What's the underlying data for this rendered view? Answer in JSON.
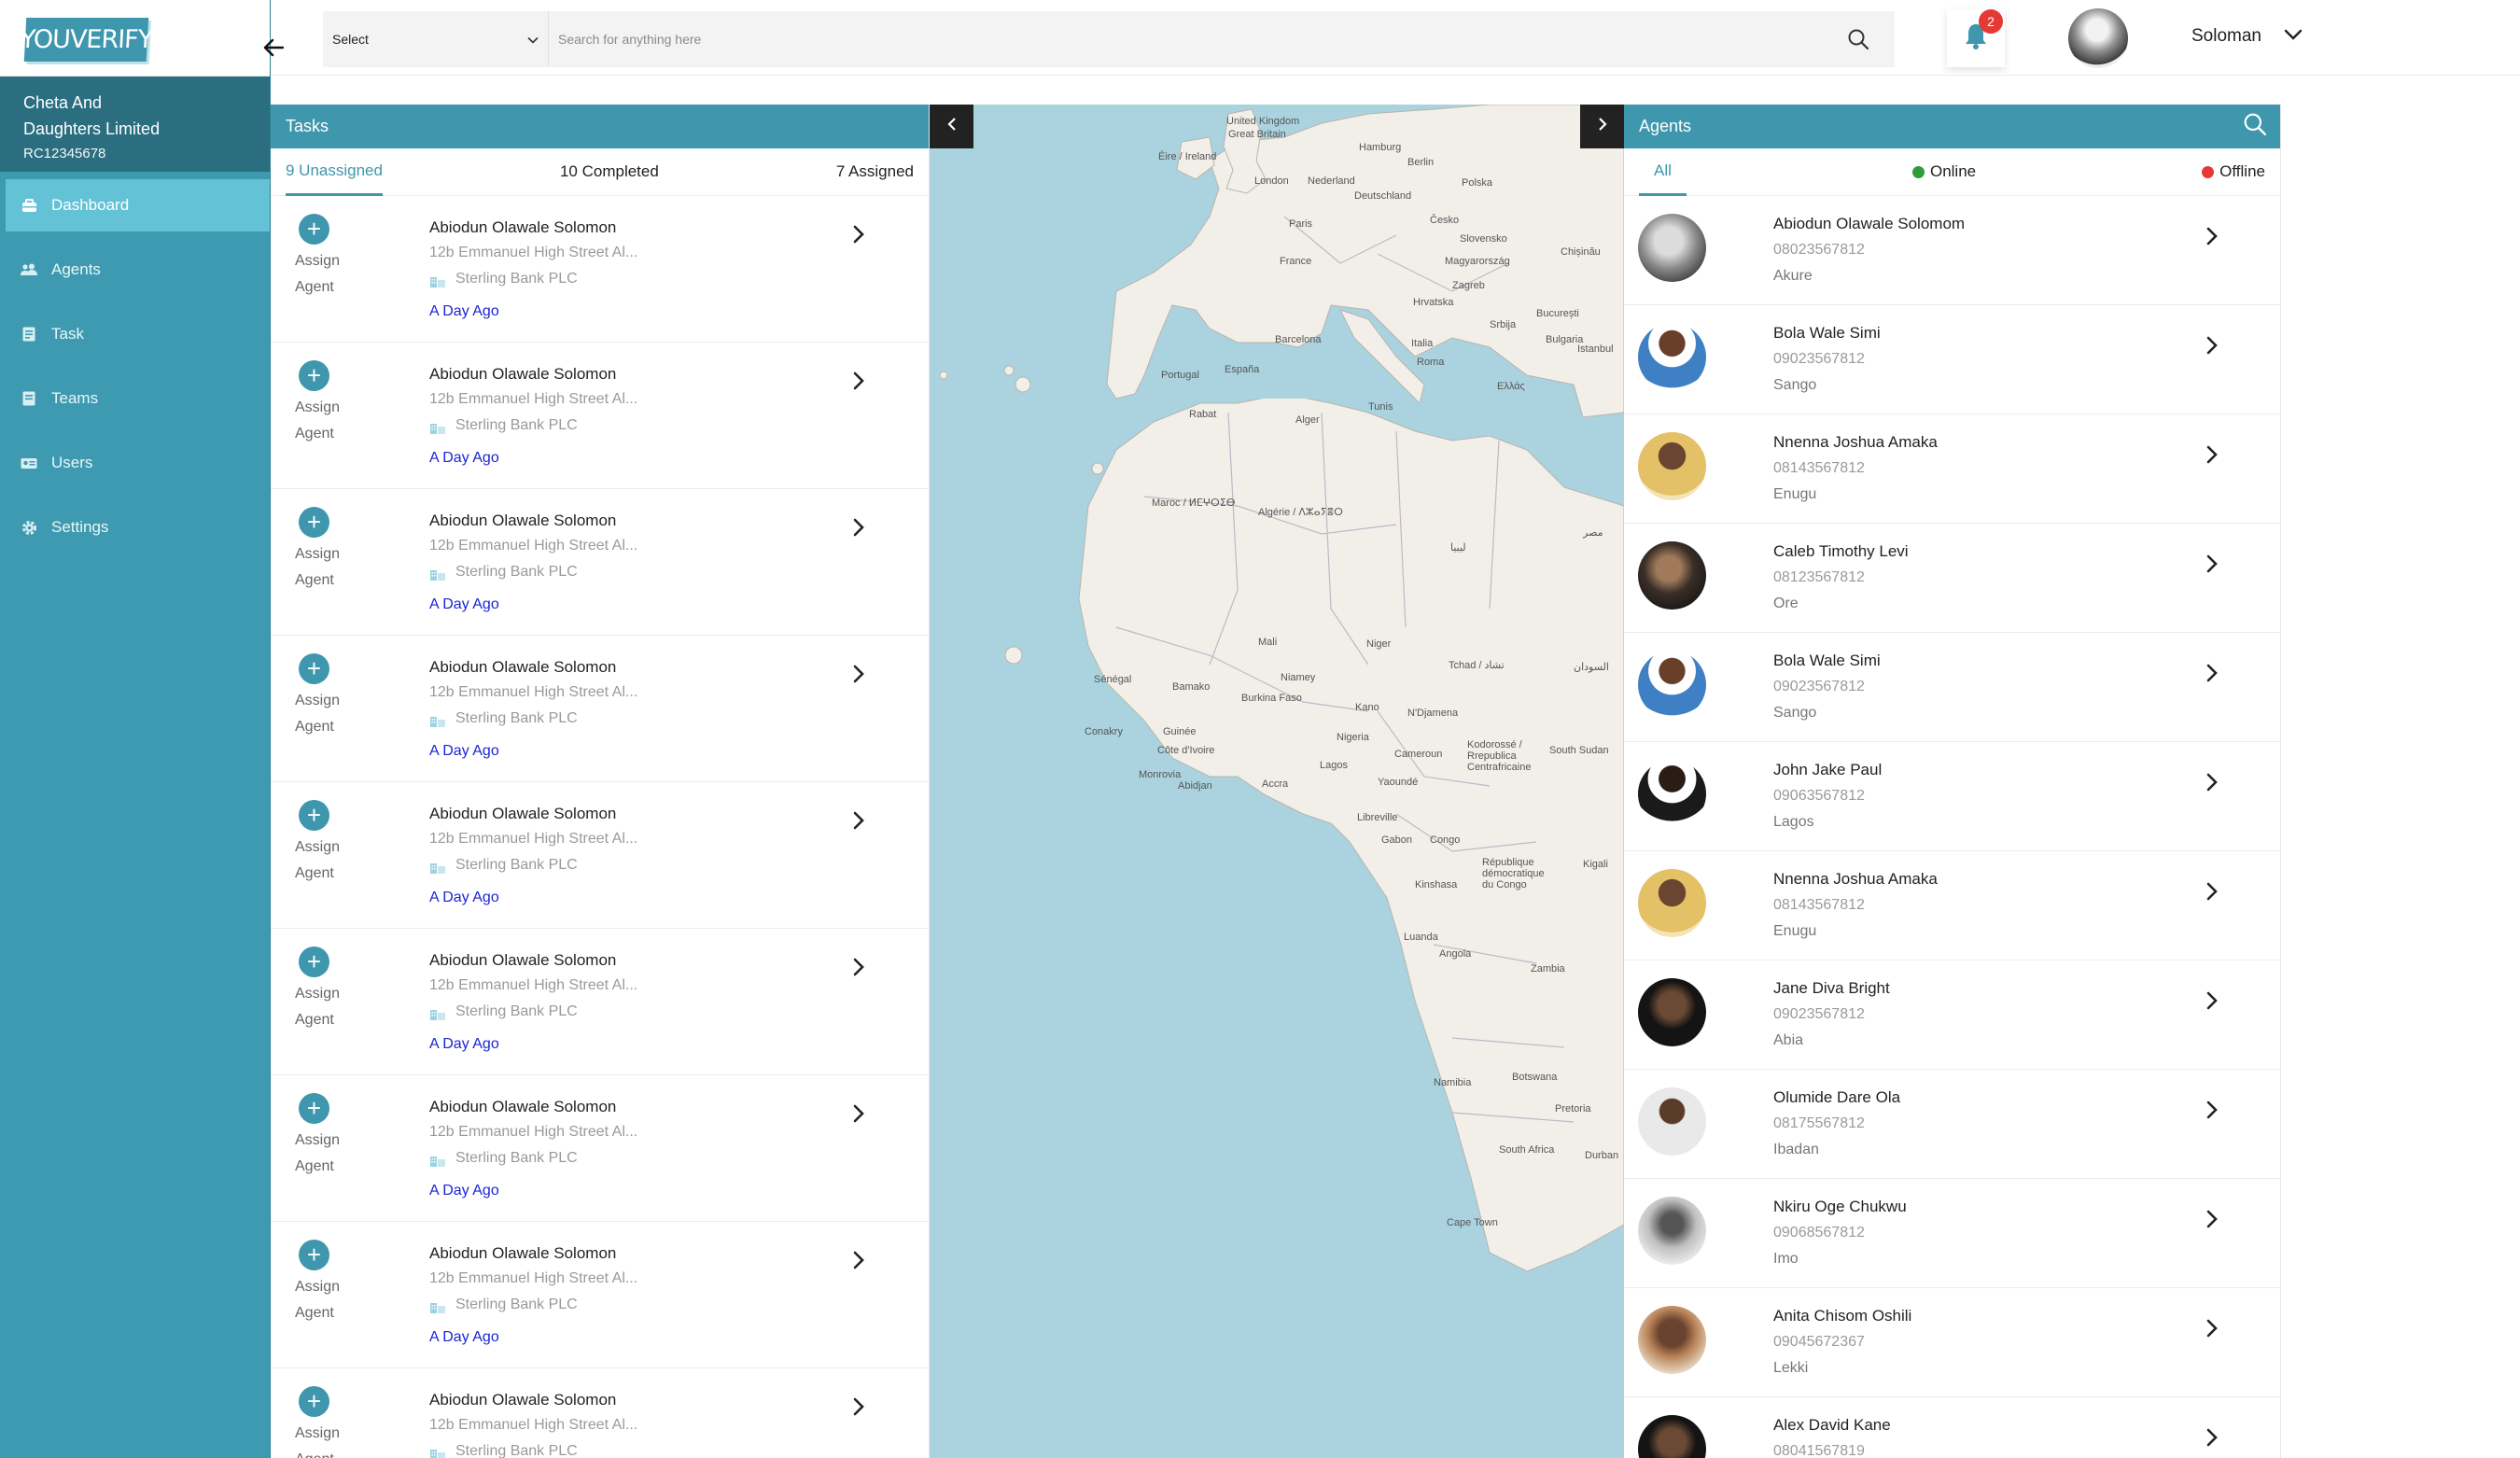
{
  "brand": {
    "logo_text": "YOUVERIFY"
  },
  "org": {
    "name_line1": "Cheta And",
    "name_line2": "Daughters Limited",
    "rc": "RC12345678"
  },
  "sidebar": {
    "items": [
      {
        "label": "Dashboard",
        "icon": "dashboard-icon",
        "active": true
      },
      {
        "label": "Agents",
        "icon": "agents-icon",
        "active": false
      },
      {
        "label": "Task",
        "icon": "task-icon",
        "active": false
      },
      {
        "label": "Teams",
        "icon": "teams-icon",
        "active": false
      },
      {
        "label": "Users",
        "icon": "users-icon",
        "active": false
      },
      {
        "label": "Settings",
        "icon": "settings-icon",
        "active": false
      }
    ]
  },
  "header": {
    "select_value": "Select",
    "search_placeholder": "Search for anything here",
    "notification_count": "2",
    "user_name": "Soloman"
  },
  "tasks": {
    "title": "Tasks",
    "tabs": [
      "9 Unassigned",
      "10 Completed",
      "7 Assigned"
    ],
    "assign_line1": "Assign",
    "assign_line2": "Agent",
    "items": [
      {
        "name": "Abiodun Olawale Solomon",
        "address": "12b Emmanuel High Street Al...",
        "bank": "Sterling Bank PLC",
        "time": "A Day Ago"
      },
      {
        "name": "Abiodun Olawale Solomon",
        "address": "12b Emmanuel High Street Al...",
        "bank": "Sterling Bank PLC",
        "time": "A Day Ago"
      },
      {
        "name": "Abiodun Olawale Solomon",
        "address": "12b Emmanuel High Street Al...",
        "bank": "Sterling Bank PLC",
        "time": "A Day Ago"
      },
      {
        "name": "Abiodun Olawale Solomon",
        "address": "12b Emmanuel High Street Al...",
        "bank": "Sterling Bank PLC",
        "time": "A Day Ago"
      },
      {
        "name": "Abiodun Olawale Solomon",
        "address": "12b Emmanuel High Street Al...",
        "bank": "Sterling Bank PLC",
        "time": "A Day Ago"
      },
      {
        "name": "Abiodun Olawale Solomon",
        "address": "12b Emmanuel High Street Al...",
        "bank": "Sterling Bank PLC",
        "time": "A Day Ago"
      },
      {
        "name": "Abiodun Olawale Solomon",
        "address": "12b Emmanuel High Street Al...",
        "bank": "Sterling Bank PLC",
        "time": "A Day Ago"
      },
      {
        "name": "Abiodun Olawale Solomon",
        "address": "12b Emmanuel High Street Al...",
        "bank": "Sterling Bank PLC",
        "time": "A Day Ago"
      },
      {
        "name": "Abiodun Olawale Solomon",
        "address": "12b Emmanuel High Street Al...",
        "bank": "Sterling Bank PLC",
        "time": ""
      }
    ]
  },
  "map": {
    "labels": [
      "United Kingdom",
      "Great Britain",
      "Éire / Ireland",
      "London",
      "Nederland",
      "Hamburg",
      "Berlin",
      "Polska",
      "Deutschland",
      "Česko",
      "Slovensko",
      "Paris",
      "France",
      "Magyarország",
      "Chișinău",
      "Zagreb",
      "Hrvatska",
      "București",
      "Srbija",
      "Bulgaria",
      "Barcelona",
      "Italia",
      "Istanbul",
      "España",
      "Portugal",
      "Ελλάς",
      "Roma",
      "Rabat",
      "Alger",
      "Tunis",
      "Maroc / ⵍⵎⵖⵔⵉⴱ",
      "Algérie / ⴷⵣⴰⵢⴻⵔ",
      "ليبيا",
      "مصر",
      "Mali",
      "Niger",
      "Tchad / تشاد",
      "السودان",
      "Sénégal",
      "Bamako",
      "Niamey",
      "Burkina Faso",
      "Guinée",
      "Côte d'Ivoire",
      "Nigeria",
      "Kano",
      "N'Djamena",
      "Conakry",
      "Monrovia",
      "Abidjan",
      "Accra",
      "Lagos",
      "Cameroun",
      "Yaoundé",
      "Kodorossé / Rrepublica Centrafricaine",
      "South Sudan",
      "Libreville",
      "Gabon",
      "Congo",
      "République démocratique du Congo",
      "Kinshasa",
      "Kigali",
      "Angola",
      "Luanda",
      "Zambia",
      "Namibia",
      "Botswana",
      "Pretoria",
      "South Africa",
      "Durban",
      "Cape Town"
    ]
  },
  "agents": {
    "title": "Agents",
    "tabs": {
      "all": "All",
      "online": "Online",
      "offline": "Offline"
    },
    "colors": {
      "online": "#2e9d3a",
      "offline": "#e53935"
    },
    "items": [
      {
        "name": "Abiodun Olawale Solomom",
        "phone": "08023567812",
        "location": "Akure",
        "photo": "grey"
      },
      {
        "name": "Bola Wale Simi",
        "phone": "09023567812",
        "location": "Sango",
        "photo": "blue"
      },
      {
        "name": "Nnenna Joshua Amaka",
        "phone": "08143567812",
        "location": "Enugu",
        "photo": "yellow"
      },
      {
        "name": "Caleb Timothy Levi",
        "phone": "08123567812",
        "location": "Ore",
        "photo": "dark"
      },
      {
        "name": "Bola Wale Simi",
        "phone": "09023567812",
        "location": "Sango",
        "photo": "blue"
      },
      {
        "name": "John Jake Paul",
        "phone": "09063567812",
        "location": "Lagos",
        "photo": "white"
      },
      {
        "name": "Nnenna Joshua Amaka",
        "phone": "08143567812",
        "location": "Enugu",
        "photo": "yellow"
      },
      {
        "name": "Jane Diva Bright",
        "phone": "09023567812",
        "location": "Abia",
        "photo": "black"
      },
      {
        "name": "Olumide Dare Ola",
        "phone": "08175567812",
        "location": "Ibadan",
        "photo": "light"
      },
      {
        "name": "Nkiru Oge Chukwu",
        "phone": "09068567812",
        "location": "Imo",
        "photo": "mono"
      },
      {
        "name": "Anita Chisom Oshili",
        "phone": "09045672367",
        "location": "Lekki",
        "photo": "warm"
      },
      {
        "name": "Alex David Kane",
        "phone": "08041567819",
        "location": "",
        "photo": "black"
      }
    ]
  }
}
